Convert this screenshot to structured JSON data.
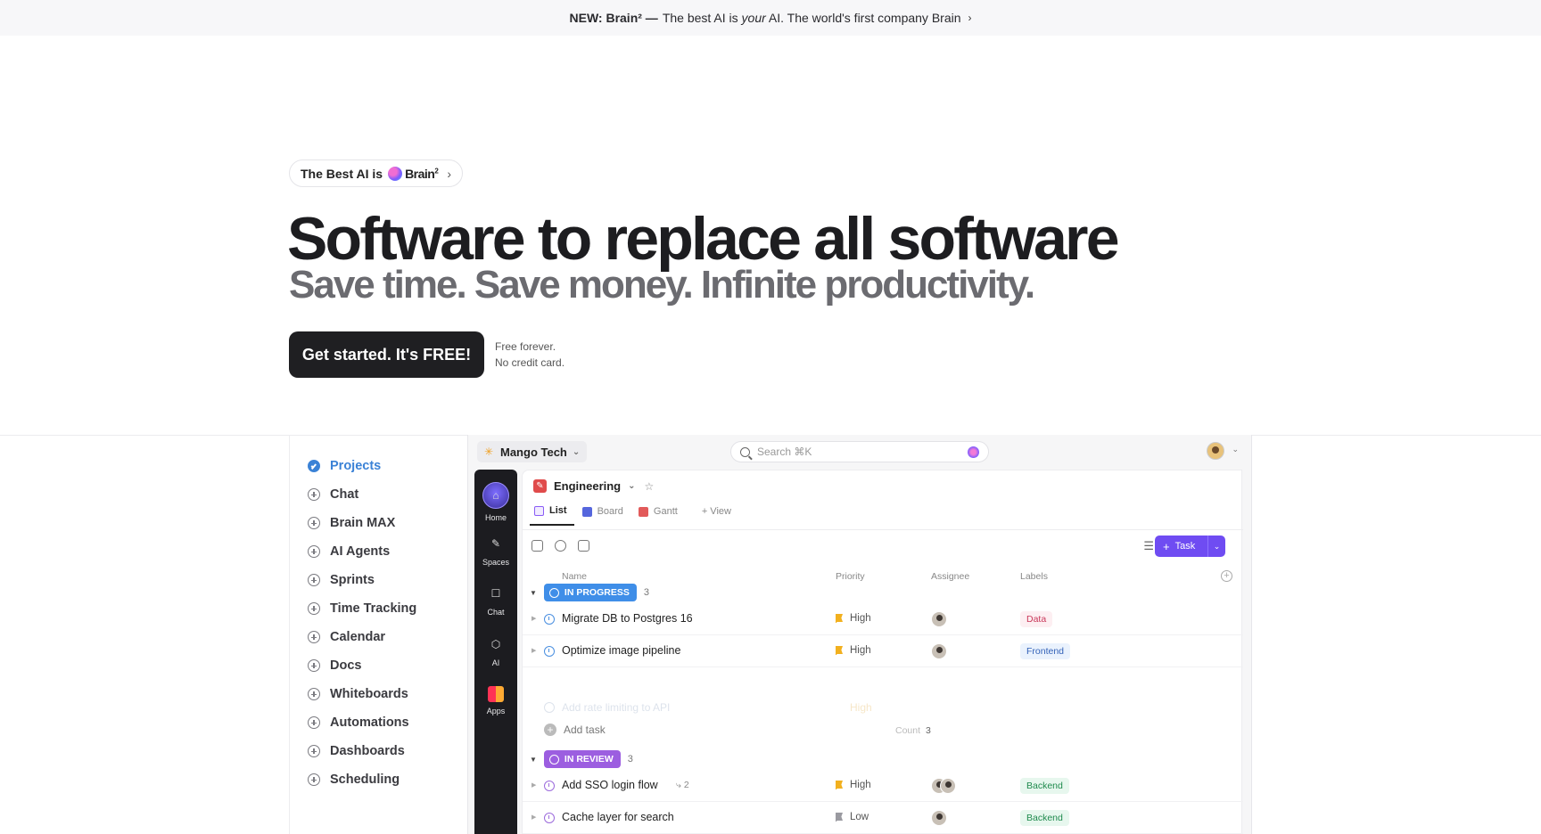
{
  "banner": {
    "prefix": "NEW: Brain² —",
    "text_a": "The best AI is",
    "text_em": "your",
    "text_b": "AI. The world's first company Brain",
    "chevron": "›"
  },
  "pill": {
    "prefix": "The Best AI is",
    "brain": "Brain",
    "sup": "2",
    "chevron": "›"
  },
  "hero": {
    "title": "Software to replace all software",
    "subtitle": "Save time. Save money. Infinite productivity."
  },
  "cta": {
    "label": "Get started. It's FREE!",
    "note1": "Free forever.",
    "note2": "No credit card."
  },
  "features": [
    {
      "label": "Projects",
      "active": true
    },
    {
      "label": "Chat"
    },
    {
      "label": "Brain MAX"
    },
    {
      "label": "AI Agents"
    },
    {
      "label": "Sprints"
    },
    {
      "label": "Time Tracking"
    },
    {
      "label": "Calendar"
    },
    {
      "label": "Docs"
    },
    {
      "label": "Whiteboards"
    },
    {
      "label": "Automations"
    },
    {
      "label": "Dashboards"
    },
    {
      "label": "Scheduling"
    }
  ],
  "app": {
    "workspace": "Mango Tech",
    "search_placeholder": "Search ⌘K",
    "rail": [
      {
        "label": "Home",
        "icon": "home-icon"
      },
      {
        "label": "Spaces",
        "icon": "spaces-icon"
      },
      {
        "label": "Chat",
        "icon": "chat-icon"
      },
      {
        "label": "AI",
        "icon": "ai-icon"
      },
      {
        "label": "Apps",
        "icon": "apps-icon"
      }
    ],
    "project": "Engineering",
    "tabs": [
      "List",
      "Board",
      "Gantt",
      "+ View"
    ],
    "task_button": "Task",
    "columns": {
      "name": "Name",
      "priority": "Priority",
      "assignee": "Assignee",
      "labels": "Labels"
    },
    "groups": [
      {
        "status": "IN PROGRESS",
        "count": "3",
        "color": "#3f8ee8"
      },
      {
        "status": "IN REVIEW",
        "count": "3",
        "color": "#9c5ee0"
      }
    ],
    "rows": [
      {
        "name": "Migrate DB to Postgres 16",
        "priority": "High",
        "label": "Data"
      },
      {
        "name": "Optimize image pipeline",
        "priority": "High",
        "label": "Frontend"
      },
      {
        "name": "Add rate limiting to API",
        "priority": "High"
      },
      {
        "name": "Add SSO login flow",
        "subtasks": "2",
        "priority": "High",
        "label": "Backend"
      },
      {
        "name": "Cache layer for search",
        "priority": "Low",
        "label": "Backend"
      }
    ],
    "add_task": "Add task",
    "count_label": "Count",
    "count_value": "3"
  }
}
